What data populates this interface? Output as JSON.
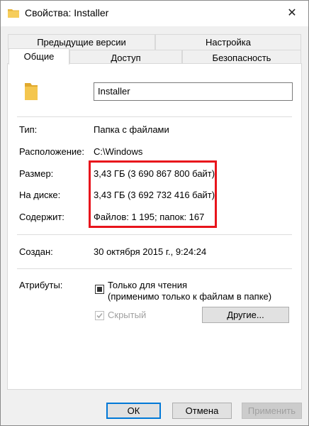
{
  "window": {
    "title": "Свойства: Installer",
    "close_glyph": "✕"
  },
  "tabs_back": [
    "Предыдущие версии",
    "Настройка"
  ],
  "tabs_front": [
    "Общие",
    "Доступ",
    "Безопасность"
  ],
  "folder_name": "Installer",
  "rows": {
    "type_label": "Тип:",
    "type_value": "Папка с файлами",
    "location_label": "Расположение:",
    "location_value": "C:\\Windows",
    "size_label": "Размер:",
    "size_value": "3,43 ГБ (3 690 867 800 байт)",
    "disk_label": "На диске:",
    "disk_value": "3,43 ГБ (3 692 732 416 байт)",
    "contains_label": "Содержит:",
    "contains_value": "Файлов: 1 195; папок: 167",
    "created_label": "Создан:",
    "created_value": "30 октября 2015 г., 9:24:24"
  },
  "attributes": {
    "label": "Атрибуты:",
    "readonly_line1": "Только для чтения",
    "readonly_line2": "(применимо только к файлам в папке)",
    "hidden": "Скрытый",
    "other_button": "Другие..."
  },
  "buttons": {
    "ok": "ОК",
    "cancel": "Отмена",
    "apply": "Применить"
  },
  "colors": {
    "highlight": "#e8141c",
    "accent": "#0078d7",
    "folder": "#f4c64e"
  }
}
